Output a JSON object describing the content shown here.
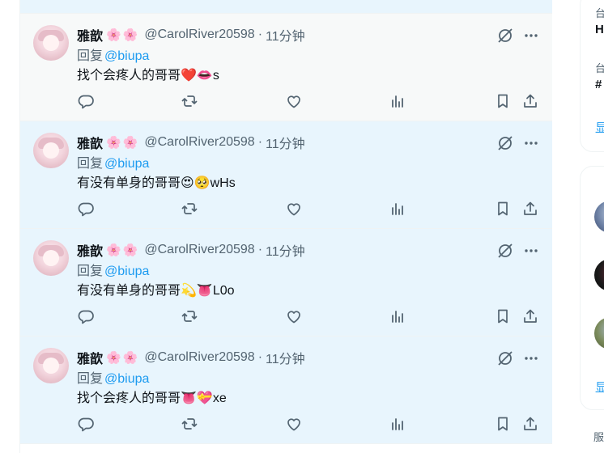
{
  "tweets": [
    {
      "display_name": "雅歆",
      "flowers": "🌸🌸",
      "handle": "@CarolRiver20598",
      "separator": "·",
      "time": "11分钟",
      "reply_prefix": "回复",
      "reply_to": "@biupa",
      "text": "找个会疼人的哥哥❤️👄s"
    },
    {
      "display_name": "雅歆",
      "flowers": "🌸🌸",
      "handle": "@CarolRiver20598",
      "separator": "·",
      "time": "11分钟",
      "reply_prefix": "回复",
      "reply_to": "@biupa",
      "text": "有没有单身的哥哥😍🥺wHs"
    },
    {
      "display_name": "雅歆",
      "flowers": "🌸🌸",
      "handle": "@CarolRiver20598",
      "separator": "·",
      "time": "11分钟",
      "reply_prefix": "回复",
      "reply_to": "@biupa",
      "text": "有没有单身的哥哥💫👅L0o"
    },
    {
      "display_name": "雅歆",
      "flowers": "🌸🌸",
      "handle": "@CarolRiver20598",
      "separator": "·",
      "time": "11分钟",
      "reply_prefix": "回复",
      "reply_to": "@biupa",
      "text": "找个会疼人的哥哥👅💝xe"
    }
  ],
  "right_sidebar": {
    "trend1_meta": "台",
    "trend1_title": "H",
    "trend2_meta": "台",
    "trend2_title": "#",
    "show_more_1": "显",
    "show_more_2": "显",
    "footer": "服"
  },
  "colors": {
    "accent": "#1d9bf0",
    "highlight_bg": "#e8f5fd",
    "normal_bg": "#f7f9f9",
    "secondary_text": "#536471"
  }
}
